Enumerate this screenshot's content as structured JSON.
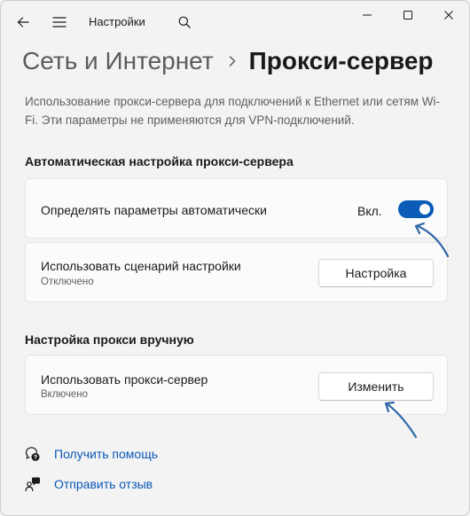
{
  "titlebar": {
    "app_title": "Настройки",
    "icons": {
      "back": "back-arrow-icon",
      "menu": "hamburger-menu-icon",
      "search": "search-icon"
    },
    "window_controls": [
      "minimize",
      "maximize",
      "close"
    ]
  },
  "breadcrumb": {
    "parent": "Сеть и Интернет",
    "current": "Прокси-сервер"
  },
  "description": "Использование прокси-сервера для подключений к Ethernet или сетям Wi-Fi. Эти параметры не применяются для VPN-подключений.",
  "auto_section": {
    "heading": "Автоматическая настройка прокси-сервера",
    "detect": {
      "label": "Определять параметры автоматически",
      "toggle_state_label": "Вкл.",
      "toggle_on": true
    },
    "script": {
      "label": "Использовать сценарий настройки",
      "status": "Отключено",
      "button_label": "Настройка"
    }
  },
  "manual_section": {
    "heading": "Настройка прокси вручную",
    "use_proxy": {
      "label": "Использовать прокси-сервер",
      "status": "Включено",
      "button_label": "Изменить"
    }
  },
  "links": {
    "help": "Получить помощь",
    "feedback": "Отправить отзыв"
  },
  "colors": {
    "accent": "#0a5cb8",
    "link": "#0a57b8",
    "annotation_arrow": "#2f67a8"
  }
}
